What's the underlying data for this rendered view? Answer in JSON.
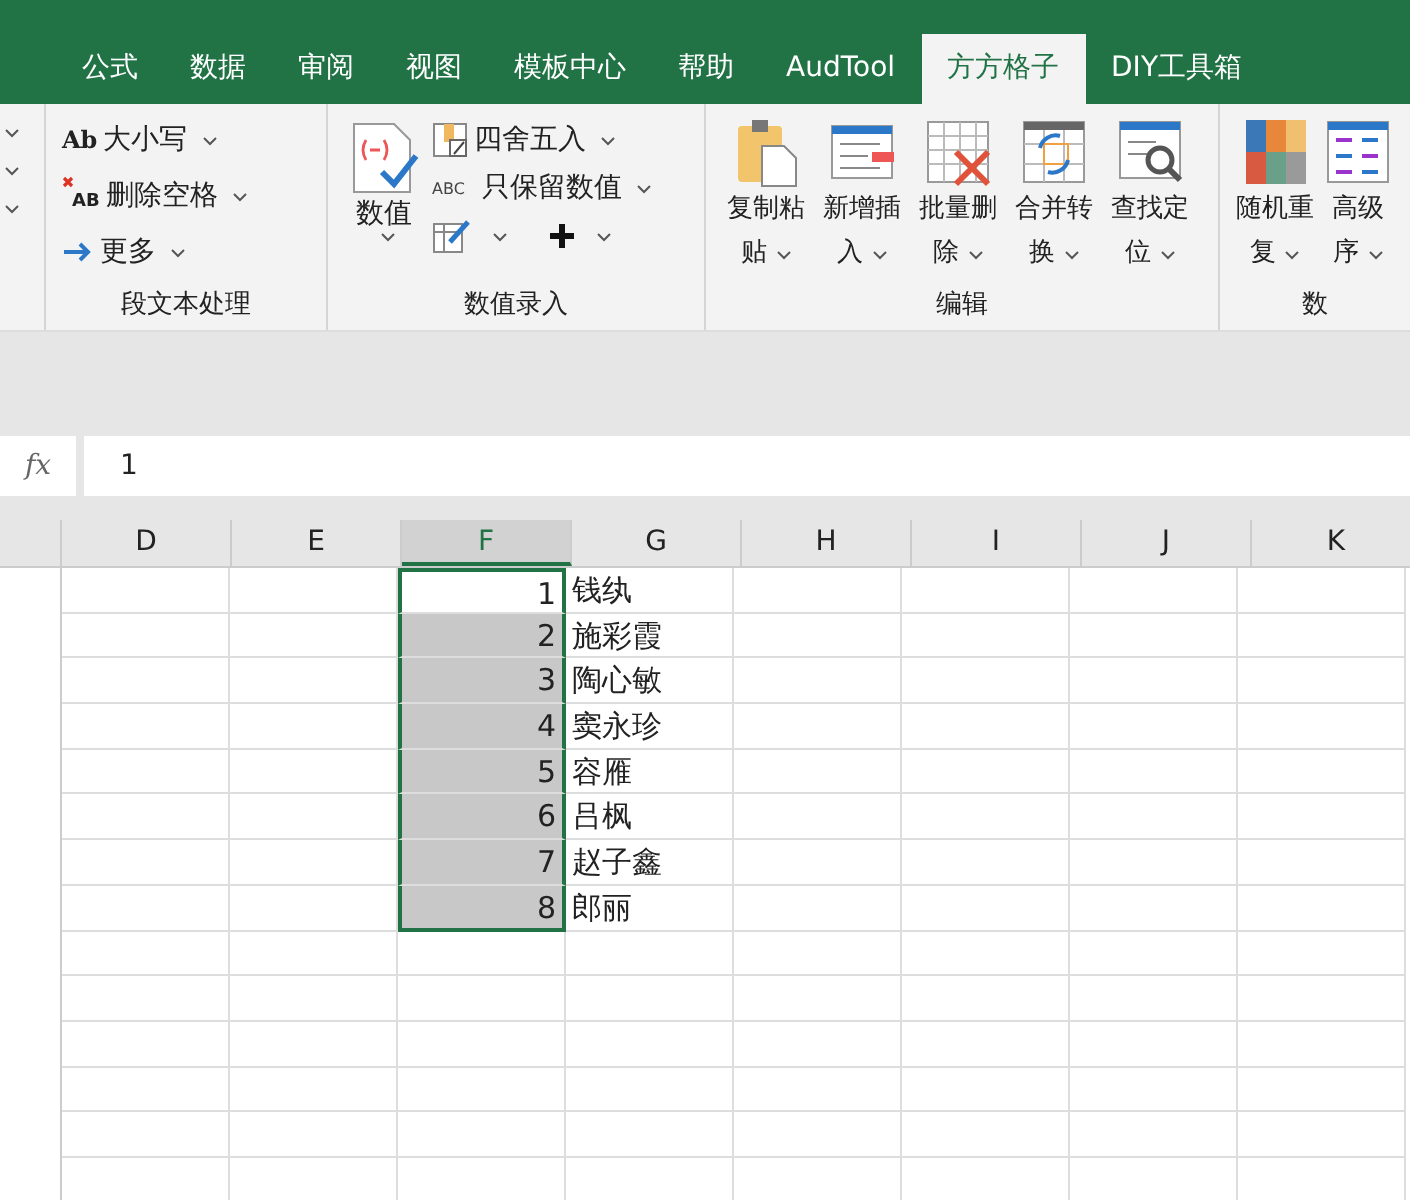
{
  "tabs": [
    {
      "label": "公式",
      "selected": false
    },
    {
      "label": "数据",
      "selected": false
    },
    {
      "label": "审阅",
      "selected": false
    },
    {
      "label": "视图",
      "selected": false
    },
    {
      "label": "模板中心",
      "selected": false
    },
    {
      "label": "帮助",
      "selected": false
    },
    {
      "label": "AudTool",
      "selected": false
    },
    {
      "label": "方方格子",
      "selected": true
    },
    {
      "label": "DIY工具箱",
      "selected": false
    }
  ],
  "ribbon": {
    "text_group": {
      "label": "段文本处理",
      "items": [
        {
          "kind": "case",
          "icon_text": "Ab",
          "label": "大小写"
        },
        {
          "kind": "trim",
          "icon_text": "AB",
          "label": "删除空格"
        },
        {
          "kind": "more",
          "label": "更多"
        }
      ]
    },
    "number_group": {
      "label": "数值录入",
      "big": "数值",
      "items": [
        {
          "kind": "round",
          "label": "四舍五入"
        },
        {
          "kind": "keep",
          "icon_text": "ABC",
          "label": "只保留数值"
        }
      ]
    },
    "edit_group": {
      "label": "编辑",
      "buttons": [
        {
          "kind": "paste",
          "line1": "复制粘",
          "line2": "贴"
        },
        {
          "kind": "insert",
          "line1": "新增插",
          "line2": "入"
        },
        {
          "kind": "delete",
          "line1": "批量删",
          "line2": "除"
        },
        {
          "kind": "merge",
          "line1": "合并转",
          "line2": "换"
        },
        {
          "kind": "find",
          "line1": "查找定",
          "line2": "位"
        }
      ]
    },
    "data_group": {
      "label": "数",
      "buttons": [
        {
          "kind": "random",
          "line1": "随机重",
          "line2": "复"
        },
        {
          "kind": "sort",
          "line1": "高级",
          "line2": "序"
        }
      ]
    }
  },
  "formula_bar": {
    "fx": "fx",
    "value": "1"
  },
  "columns": [
    {
      "label": "D",
      "selected": false
    },
    {
      "label": "E",
      "selected": false
    },
    {
      "label": "F",
      "selected": true
    },
    {
      "label": "G",
      "selected": false
    },
    {
      "label": "H",
      "selected": false
    },
    {
      "label": "I",
      "selected": false
    },
    {
      "label": "J",
      "selected": false
    },
    {
      "label": "K",
      "selected": false
    }
  ],
  "rows": [
    {
      "value": "1",
      "name": "钱纨",
      "selected": true,
      "active": true
    },
    {
      "value": "2",
      "name": "施彩霞",
      "selected": true,
      "active": false
    },
    {
      "value": "3",
      "name": "陶心敏",
      "selected": true,
      "active": false
    },
    {
      "value": "4",
      "name": "窦永珍",
      "selected": true,
      "active": false
    },
    {
      "value": "5",
      "name": "容雁",
      "selected": true,
      "active": false
    },
    {
      "value": "6",
      "name": "吕枫",
      "selected": true,
      "active": false
    },
    {
      "value": "7",
      "name": "赵子鑫",
      "selected": true,
      "active": false
    },
    {
      "value": "8",
      "name": "郎丽",
      "selected": true,
      "active": false
    }
  ]
}
